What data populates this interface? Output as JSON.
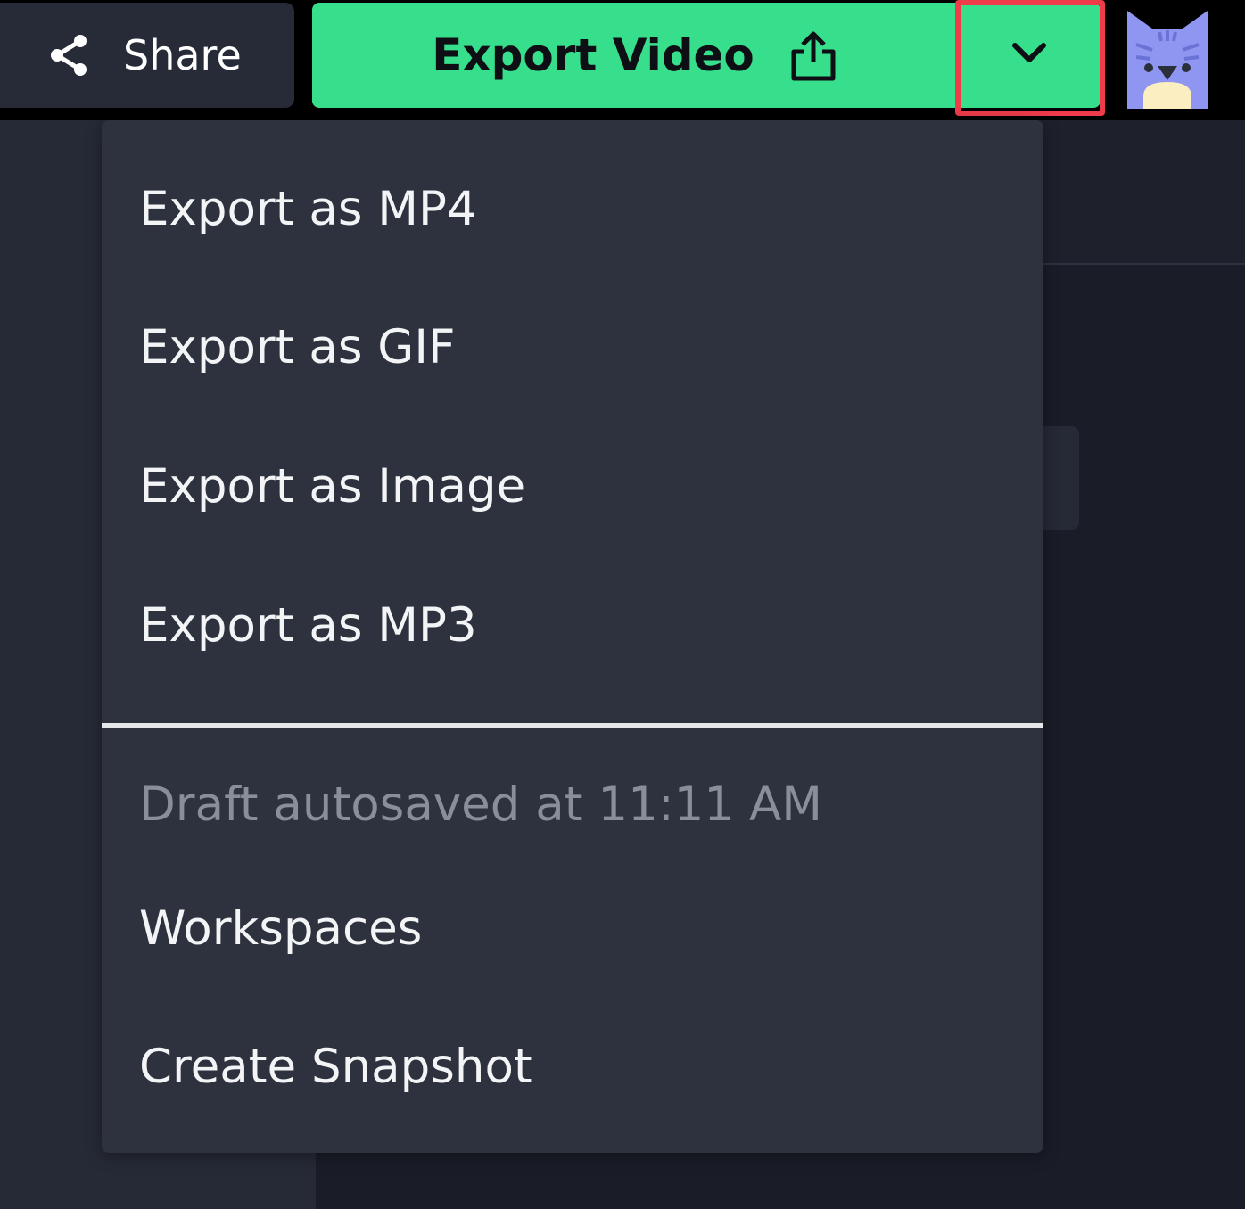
{
  "header": {
    "share_label": "Share",
    "share_icon": "share-icon",
    "export_label": "Export Video",
    "export_icon": "upload-icon",
    "dropdown_icon": "chevron-down-icon",
    "avatar_icon": "cat-avatar-icon"
  },
  "menu": {
    "items": [
      {
        "label": "Export as MP4"
      },
      {
        "label": "Export as GIF"
      },
      {
        "label": "Export as Image"
      },
      {
        "label": "Export as MP3"
      }
    ],
    "autosave_text": "Draft autosaved at 11:11 AM",
    "secondary_items": [
      {
        "label": "Workspaces"
      },
      {
        "label": "Create Snapshot"
      }
    ]
  },
  "colors": {
    "accent_green": "#37df8c",
    "highlight_red": "#ef3b4a",
    "menu_bg": "#2e323e",
    "page_bg": "#1a1d27"
  }
}
